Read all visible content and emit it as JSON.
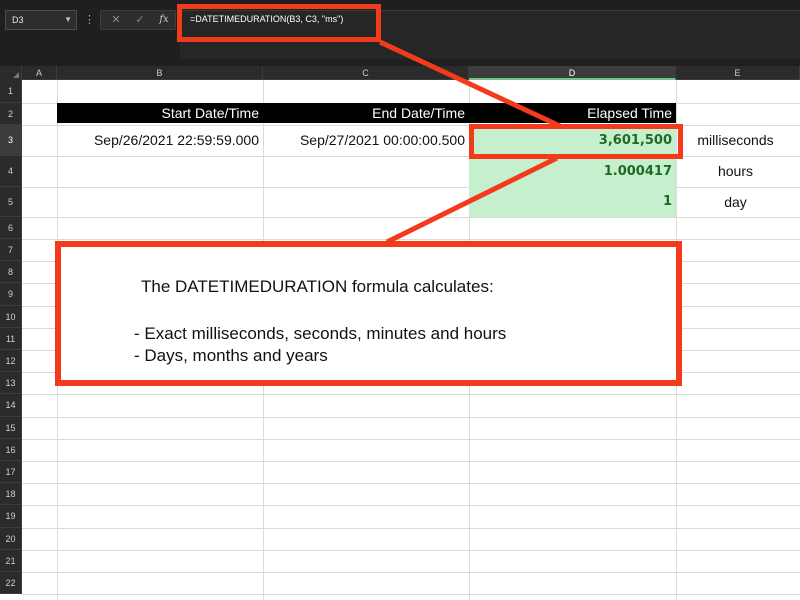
{
  "formula_bar": {
    "name_box": "D3",
    "formula": "=DATETIMEDURATION(B3, C3, \"ms\")",
    "cancel_icon": "✕",
    "enter_icon": "✓",
    "fx_label": "fx"
  },
  "columns": [
    "A",
    "B",
    "C",
    "D",
    "E"
  ],
  "selected_column": "D",
  "rows": [
    "1",
    "2",
    "3",
    "4",
    "5",
    "6",
    "7",
    "8",
    "9",
    "10",
    "11",
    "12",
    "13",
    "14",
    "15",
    "16",
    "17",
    "18",
    "19",
    "20",
    "21",
    "22"
  ],
  "selected_row": "3",
  "table": {
    "header": {
      "start": "Start Date/Time",
      "end": "End Date/Time",
      "elapsed": "Elapsed Time"
    },
    "start_value": "Sep/26/2021 22:59:59.000",
    "end_value": "Sep/27/2021 00:00:00.500",
    "results": [
      {
        "value": "3,601,500",
        "unit": "milliseconds"
      },
      {
        "value": "1.000417",
        "unit": "hours"
      },
      {
        "value": "1",
        "unit": "day"
      }
    ]
  },
  "callout": {
    "title": "The DATETIMEDURATION formula calculates:",
    "line1": "- Exact milliseconds, seconds, minutes and hours",
    "line2": "- Days, months and years"
  },
  "colors": {
    "accent_red": "#f23b1a",
    "result_fill": "#c6efce",
    "result_text": "#1e6a25"
  }
}
